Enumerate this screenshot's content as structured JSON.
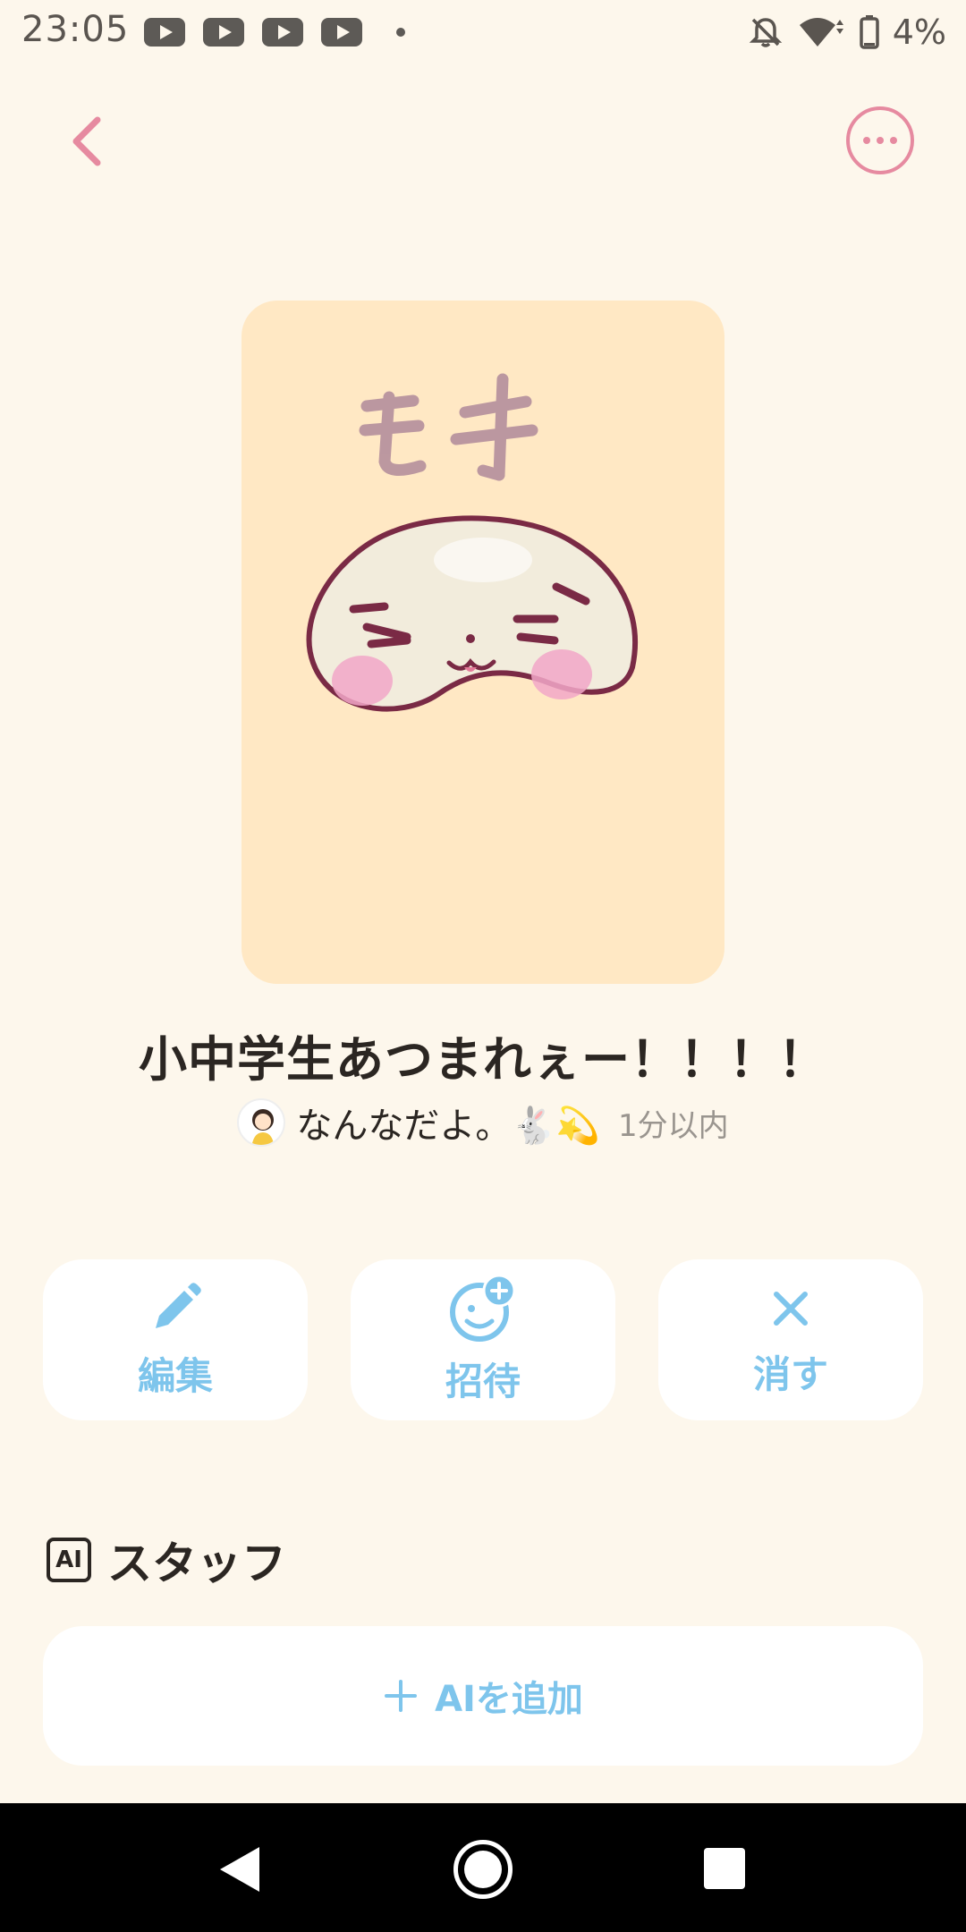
{
  "status_bar": {
    "time": "23:05",
    "notification_icons": [
      "youtube-icon",
      "youtube-icon",
      "youtube-icon",
      "youtube-icon"
    ],
    "battery": "4%"
  },
  "header": {
    "back_icon": "chevron-left-icon",
    "more_icon": "more-horizontal-icon"
  },
  "cover": {
    "drawn_text": "モチ"
  },
  "group": {
    "title": "小中学生あつまれぇー！！！！",
    "owner_name": "なんなだよ。🐇💫",
    "updated": "1分以内"
  },
  "actions": [
    {
      "label": "編集",
      "icon": "pencil-icon"
    },
    {
      "label": "招待",
      "icon": "invite-icon"
    },
    {
      "label": "消す",
      "icon": "close-icon"
    }
  ],
  "staff": {
    "badge": "AI",
    "title": "スタッフ",
    "add_label": "AIを追加"
  },
  "colors": {
    "background": "#fdf7ec",
    "accent_pink": "#e68aa0",
    "accent_blue": "#7ec5ec",
    "cover_bg": "#ffe8c4"
  }
}
